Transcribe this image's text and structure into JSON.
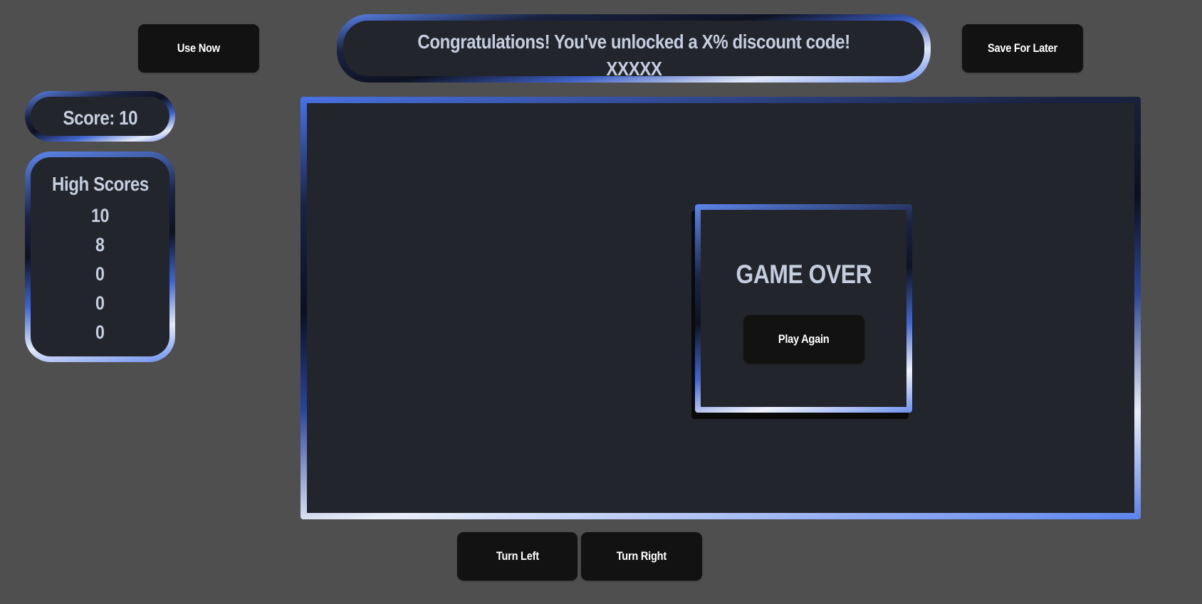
{
  "banner": {
    "message": "Congratulations! You've unlocked a X% discount code!",
    "code": "XXXXX"
  },
  "buttons": {
    "use_now": "Use Now",
    "save_for_later": "Save For Later",
    "play_again": "Play Again",
    "turn_left": "Turn Left",
    "turn_right": "Turn Right"
  },
  "score": {
    "label": "Score: 10"
  },
  "high_scores": {
    "title": "High Scores",
    "values": [
      "10",
      "8",
      "0",
      "0",
      "0"
    ]
  },
  "game_over": {
    "title": "GAME OVER"
  },
  "colors": {
    "page_background": "#4f4f4f",
    "panel_background": "#22252b",
    "button_background": "#121212",
    "accent_blue": "#5a82ee",
    "text": "#c4cedf"
  }
}
